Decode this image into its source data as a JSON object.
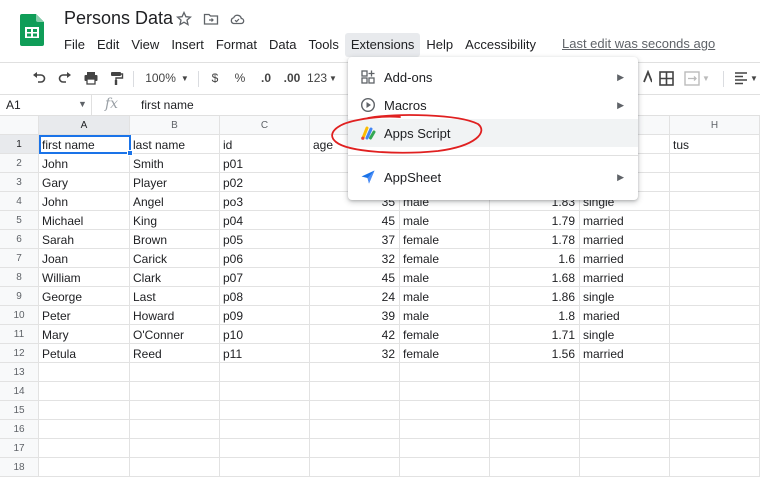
{
  "app": {
    "title": "Persons Data",
    "last_edit": "Last edit was seconds ago"
  },
  "menu": [
    "File",
    "Edit",
    "View",
    "Insert",
    "Format",
    "Data",
    "Tools",
    "Extensions",
    "Help",
    "Accessibility"
  ],
  "menu_active": "Extensions",
  "toolbar": {
    "zoom": "100%",
    "currency": "$",
    "percent": "%",
    "dec_decrease": ".0",
    "dec_increase": ".00",
    "more_formats": "123"
  },
  "formula_bar": {
    "cell_ref": "A1",
    "fx": "fx",
    "value": "first name"
  },
  "columns": [
    "A",
    "B",
    "C",
    "D",
    "E",
    "F",
    "G",
    "H"
  ],
  "row_numbers": [
    "1",
    "2",
    "3",
    "4",
    "5",
    "6",
    "7",
    "8",
    "9",
    "10",
    "11",
    "12",
    "13",
    "14",
    "15",
    "16",
    "17",
    "18"
  ],
  "header_row": [
    "first name",
    "last name",
    "id",
    "age",
    "",
    "",
    "",
    "tus"
  ],
  "rows": [
    [
      "John",
      "Smith",
      "p01",
      "",
      "",
      "",
      ""
    ],
    [
      "Gary",
      "Player",
      "p02",
      "",
      "",
      "",
      ""
    ],
    [
      "John",
      "Angel",
      "po3",
      "35",
      "male",
      "1.83",
      "single"
    ],
    [
      "Michael",
      "King",
      "p04",
      "45",
      "male",
      "1.79",
      "married"
    ],
    [
      "Sarah",
      "Brown",
      "p05",
      "37",
      "female",
      "1.78",
      "married"
    ],
    [
      "Joan",
      "Carick",
      "p06",
      "32",
      "female",
      "1.6",
      "married"
    ],
    [
      "William",
      "Clark",
      "p07",
      "45",
      "male",
      "1.68",
      "married"
    ],
    [
      "George",
      "Last",
      "p08",
      "24",
      "male",
      "1.86",
      "single"
    ],
    [
      "Peter",
      "Howard",
      "p09",
      "39",
      "male",
      "1.8",
      "maried"
    ],
    [
      "Mary",
      "O'Conner",
      "p10",
      "42",
      "female",
      "1.71",
      "single"
    ],
    [
      "Petula",
      "Reed",
      "p11",
      "32",
      "female",
      "1.56",
      "married"
    ]
  ],
  "extensions_menu": {
    "items": [
      {
        "label": "Add-ons",
        "icon": "add-ons-icon",
        "submenu": true
      },
      {
        "label": "Macros",
        "icon": "macros-icon",
        "submenu": true
      },
      {
        "label": "Apps Script",
        "icon": "apps-script-icon",
        "submenu": false
      },
      {
        "label": "AppSheet",
        "icon": "appsheet-icon",
        "submenu": true
      }
    ]
  },
  "colors": {
    "accent": "#1a73e8",
    "sheets_green": "#0f9d58",
    "annotation_red": "#e02020"
  }
}
